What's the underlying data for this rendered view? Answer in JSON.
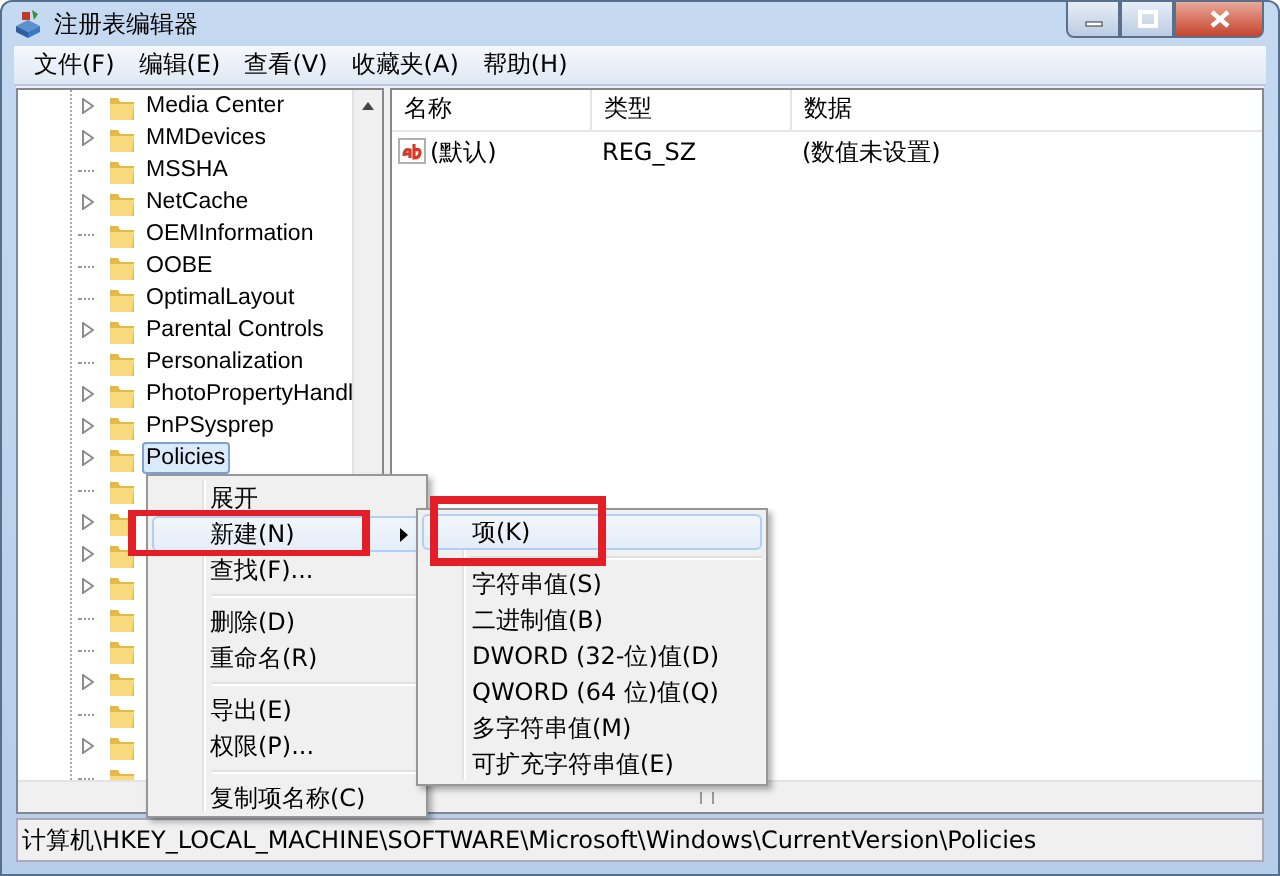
{
  "window": {
    "title": "注册表编辑器"
  },
  "menubar": [
    "文件(F)",
    "编辑(E)",
    "查看(V)",
    "收藏夹(A)",
    "帮助(H)"
  ],
  "tree": {
    "items": [
      {
        "label": "Media Center",
        "expandable": true,
        "selected": false
      },
      {
        "label": "MMDevices",
        "expandable": true,
        "selected": false
      },
      {
        "label": "MSSHA",
        "expandable": false,
        "selected": false
      },
      {
        "label": "NetCache",
        "expandable": true,
        "selected": false
      },
      {
        "label": "OEMInformation",
        "expandable": false,
        "selected": false
      },
      {
        "label": "OOBE",
        "expandable": false,
        "selected": false
      },
      {
        "label": "OptimalLayout",
        "expandable": false,
        "selected": false
      },
      {
        "label": "Parental Controls",
        "expandable": true,
        "selected": false
      },
      {
        "label": "Personalization",
        "expandable": false,
        "selected": false
      },
      {
        "label": "PhotoPropertyHandl",
        "expandable": true,
        "selected": false
      },
      {
        "label": "PnPSysprep",
        "expandable": true,
        "selected": false
      },
      {
        "label": "Policies",
        "expandable": true,
        "selected": true
      }
    ],
    "covered_items": [
      {
        "expandable": false
      },
      {
        "expandable": true
      },
      {
        "expandable": true
      },
      {
        "expandable": true
      },
      {
        "expandable": false
      },
      {
        "expandable": false
      },
      {
        "expandable": true
      },
      {
        "expandable": false
      },
      {
        "expandable": true
      },
      {
        "expandable": false
      }
    ]
  },
  "values": {
    "columns": [
      "名称",
      "类型",
      "数据"
    ],
    "rows": [
      {
        "name": "(默认)",
        "type": "REG_SZ",
        "data": "(数值未设置)"
      }
    ]
  },
  "context_menu": {
    "items": [
      {
        "kind": "item",
        "label": "展开",
        "selected": false,
        "submenu": false
      },
      {
        "kind": "item",
        "label": "新建(N)",
        "selected": true,
        "submenu": true
      },
      {
        "kind": "item",
        "label": "查找(F)...",
        "selected": false,
        "submenu": false
      },
      {
        "kind": "separator"
      },
      {
        "kind": "item",
        "label": "删除(D)",
        "selected": false,
        "submenu": false
      },
      {
        "kind": "item",
        "label": "重命名(R)",
        "selected": false,
        "submenu": false
      },
      {
        "kind": "separator"
      },
      {
        "kind": "item",
        "label": "导出(E)",
        "selected": false,
        "submenu": false
      },
      {
        "kind": "item",
        "label": "权限(P)...",
        "selected": false,
        "submenu": false
      },
      {
        "kind": "separator"
      },
      {
        "kind": "item",
        "label": "复制项名称(C)",
        "selected": false,
        "submenu": false
      }
    ]
  },
  "submenu": {
    "items": [
      {
        "kind": "item",
        "label": "项(K)",
        "selected": true
      },
      {
        "kind": "separator"
      },
      {
        "kind": "item",
        "label": "字符串值(S)",
        "selected": false
      },
      {
        "kind": "item",
        "label": "二进制值(B)",
        "selected": false
      },
      {
        "kind": "item",
        "label": "DWORD (32-位)值(D)",
        "selected": false
      },
      {
        "kind": "item",
        "label": "QWORD (64 位)值(Q)",
        "selected": false
      },
      {
        "kind": "item",
        "label": "多字符串值(M)",
        "selected": false
      },
      {
        "kind": "item",
        "label": "可扩充字符串值(E)",
        "selected": false
      }
    ]
  },
  "annotations": [
    {
      "kind": "highlight-box"
    },
    {
      "kind": "highlight-box"
    }
  ],
  "status_bar": "计算机\\HKEY_LOCAL_MACHINE\\SOFTWARE\\Microsoft\\Windows\\CurrentVersion\\Policies"
}
